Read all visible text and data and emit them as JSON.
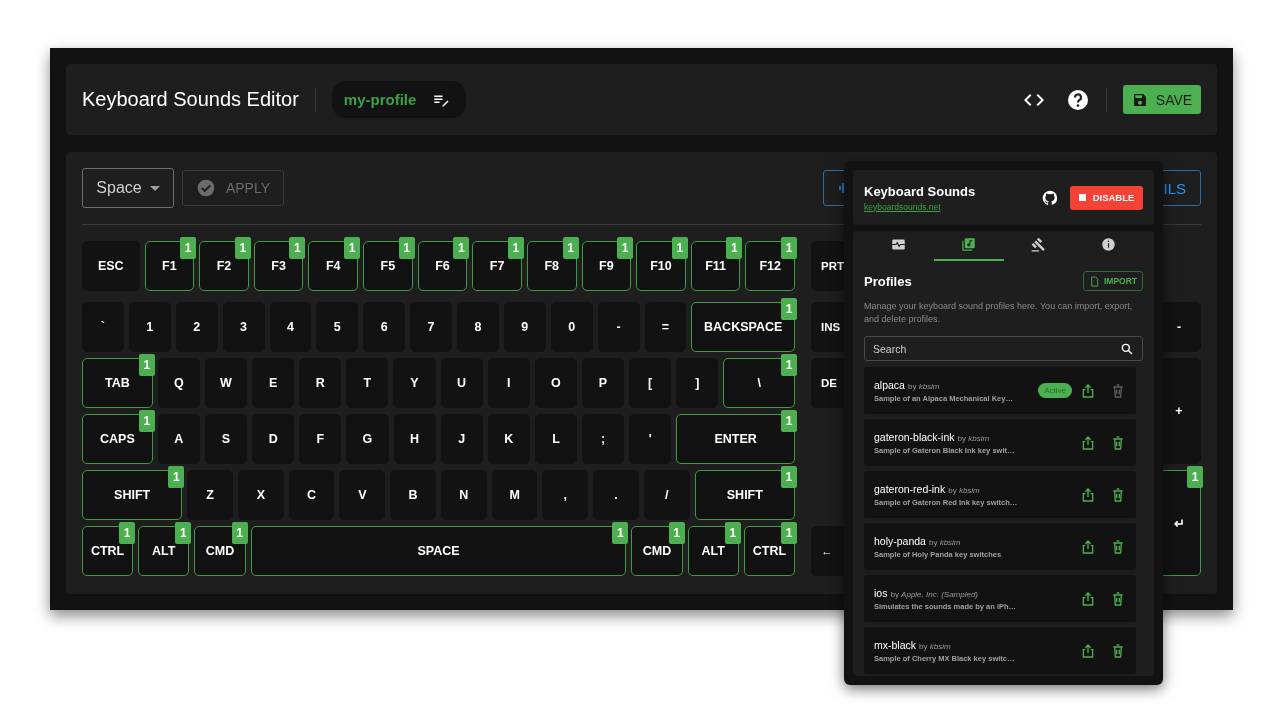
{
  "header": {
    "title": "Keyboard Sounds Editor",
    "profile_name": "my-profile",
    "save_label": "SAVE"
  },
  "editor": {
    "key_select": "Space",
    "apply_label": "APPLY",
    "apply_disabled": true,
    "details_label": "ILS"
  },
  "keyboard": {
    "rows": [
      {
        "keys": [
          {
            "label": "ESC"
          },
          {
            "label": "F1",
            "badge": "1"
          },
          {
            "label": "F2",
            "badge": "1"
          },
          {
            "label": "F3",
            "badge": "1"
          },
          {
            "label": "F4",
            "badge": "1"
          },
          {
            "label": "F5",
            "badge": "1"
          },
          {
            "label": "F6",
            "badge": "1"
          },
          {
            "label": "F7",
            "badge": "1"
          },
          {
            "label": "F8",
            "badge": "1"
          },
          {
            "label": "F9",
            "badge": "1"
          },
          {
            "label": "F10",
            "badge": "1"
          },
          {
            "label": "F11",
            "badge": "1"
          },
          {
            "label": "F12",
            "badge": "1"
          }
        ]
      },
      {
        "keys": [
          {
            "label": "`"
          },
          {
            "label": "1"
          },
          {
            "label": "2"
          },
          {
            "label": "3"
          },
          {
            "label": "4"
          },
          {
            "label": "5"
          },
          {
            "label": "6"
          },
          {
            "label": "7"
          },
          {
            "label": "8"
          },
          {
            "label": "9"
          },
          {
            "label": "0"
          },
          {
            "label": "-"
          },
          {
            "label": "="
          },
          {
            "label": "BACKSPACE",
            "badge": "1"
          }
        ]
      },
      {
        "keys": [
          {
            "label": "TAB",
            "badge": "1"
          },
          {
            "label": "Q"
          },
          {
            "label": "W"
          },
          {
            "label": "E"
          },
          {
            "label": "R"
          },
          {
            "label": "T"
          },
          {
            "label": "Y"
          },
          {
            "label": "U"
          },
          {
            "label": "I"
          },
          {
            "label": "O"
          },
          {
            "label": "P"
          },
          {
            "label": "["
          },
          {
            "label": "]"
          },
          {
            "label": "\\",
            "badge": "1"
          }
        ]
      },
      {
        "keys": [
          {
            "label": "CAPS",
            "badge": "1"
          },
          {
            "label": "A"
          },
          {
            "label": "S"
          },
          {
            "label": "D"
          },
          {
            "label": "F"
          },
          {
            "label": "G"
          },
          {
            "label": "H"
          },
          {
            "label": "J"
          },
          {
            "label": "K"
          },
          {
            "label": "L"
          },
          {
            "label": ";"
          },
          {
            "label": "'"
          },
          {
            "label": "ENTER",
            "badge": "1"
          }
        ]
      },
      {
        "keys": [
          {
            "label": "SHIFT",
            "badge": "1"
          },
          {
            "label": "Z"
          },
          {
            "label": "X"
          },
          {
            "label": "C"
          },
          {
            "label": "V"
          },
          {
            "label": "B"
          },
          {
            "label": "N"
          },
          {
            "label": "M"
          },
          {
            "label": ","
          },
          {
            "label": "."
          },
          {
            "label": "/"
          },
          {
            "label": "SHIFT",
            "badge": "1"
          }
        ]
      },
      {
        "keys": [
          {
            "label": "CTRL",
            "badge": "1"
          },
          {
            "label": "ALT",
            "badge": "1"
          },
          {
            "label": "CMD",
            "badge": "1"
          },
          {
            "label": "SPACE",
            "badge": "1"
          },
          {
            "label": "CMD",
            "badge": "1"
          },
          {
            "label": "ALT",
            "badge": "1"
          },
          {
            "label": "CTRL",
            "badge": "1"
          }
        ]
      }
    ],
    "nav_keys": [
      {
        "label": "PRT"
      },
      {
        "label": "INS"
      },
      {
        "label": "DE"
      },
      {
        "label": "←"
      }
    ],
    "numpad_keys": [
      {
        "label": "-"
      },
      {
        "label": "+"
      },
      {
        "label": "↵",
        "badge": "1"
      }
    ]
  },
  "popup": {
    "title": "Keyboard Sounds",
    "link": "keyboardsounds.net",
    "disable_label": "DISABLE",
    "tabs": [
      {
        "selected": false
      },
      {
        "selected": true
      },
      {
        "selected": false
      },
      {
        "selected": false
      }
    ],
    "section_title": "Profiles",
    "import_label": "IMPORT",
    "description": "Manage your keyboard sound profiles here. You can import, export, and delete profiles.",
    "search": {
      "placeholder": "Search"
    },
    "profiles": [
      {
        "name": "alpaca",
        "byline": "by *kbsim*",
        "description": "Sample of an Alpaca Mechanical Key…",
        "active": true,
        "badge": "Active"
      },
      {
        "name": "gateron-black-ink",
        "byline": "by *kbsim*",
        "description": "Sample of Gateron Black Ink key swit…",
        "active": false
      },
      {
        "name": "gateron-red-ink",
        "byline": "by *kbsim*",
        "description": "Sample of Gateron Red Ink key switch…",
        "active": false
      },
      {
        "name": "holy-panda",
        "byline": "by *kbsim*",
        "description": "Sample of Holy Panda key switches",
        "active": false
      },
      {
        "name": "ios",
        "byline": "by *Apple, Inc. (Sampled)*",
        "description": "Simulates the sounds made by an iPh…",
        "active": false
      },
      {
        "name": "mx-black",
        "byline": "by *kbsim*",
        "description": "Sample of Cherry MX Black key switc…",
        "active": false
      }
    ]
  }
}
